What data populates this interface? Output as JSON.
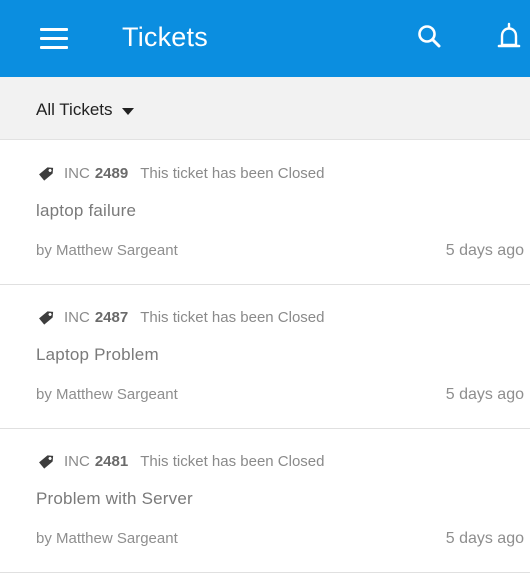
{
  "app_bar": {
    "title": "Tickets",
    "icons": {
      "menu": "hamburger-menu-icon",
      "search": "search-icon",
      "notifications": "bell-icon"
    },
    "background_color": "#0b8ee0"
  },
  "filter": {
    "selected": "All Tickets",
    "icon": "caret-down-icon"
  },
  "tickets": [
    {
      "prefix": "INC",
      "number": "2489",
      "status": "This ticket has been Closed",
      "subject": "laptop failure",
      "author": "by Matthew Sargeant",
      "time": "5 days ago"
    },
    {
      "prefix": "INC",
      "number": "2487",
      "status": "This ticket has been Closed",
      "subject": "Laptop Problem",
      "author": "by Matthew Sargeant",
      "time": "5 days ago"
    },
    {
      "prefix": "INC",
      "number": "2481",
      "status": "This ticket has been Closed",
      "subject": "Problem with Server",
      "author": "by Matthew Sargeant",
      "time": "5 days ago"
    }
  ]
}
